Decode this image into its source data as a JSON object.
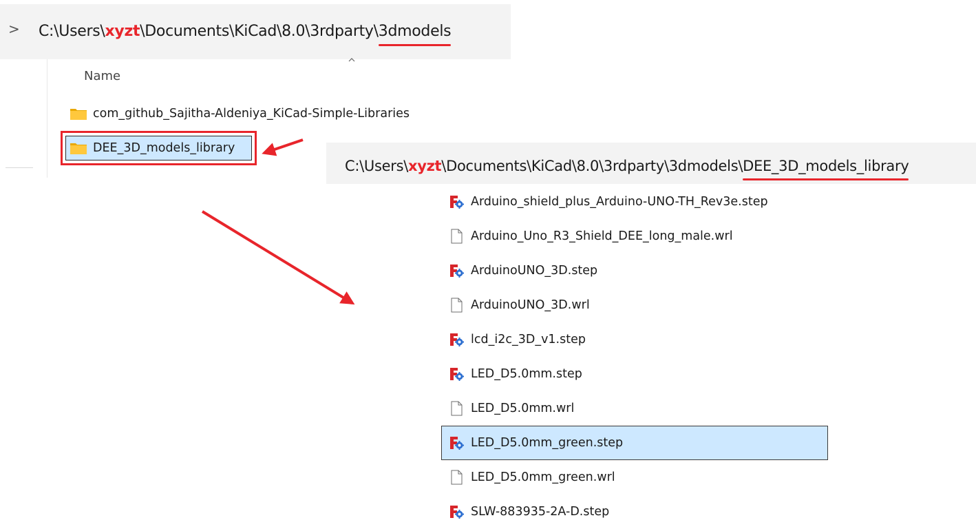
{
  "accent_color": "#e8252b",
  "selection_color": "#cde8ff",
  "top_address_bar": {
    "chevron": ">",
    "path_prefix": "C:\\Users\\",
    "user": "xyzt",
    "path_middle": "\\Documents\\KiCad\\8.0\\3rdparty\\",
    "path_last": "3dmodels"
  },
  "parent_view": {
    "column_header": "Name",
    "folders": [
      {
        "name": "com_github_Sajitha-Aldeniya_KiCad-Simple-Libraries",
        "icon": "folder-icon"
      },
      {
        "name": "DEE_3D_models_library",
        "icon": "folder-icon",
        "highlighted": true
      }
    ]
  },
  "library_address_bar": {
    "path_prefix": "C:\\Users\\",
    "user": "xyzt",
    "path_middle": "\\Documents\\KiCad\\8.0\\3rdparty\\3dmodels\\",
    "path_last": "DEE_3D_models_library"
  },
  "library_files": [
    {
      "name": "Arduino_shield_plus_Arduino-UNO-TH_Rev3e.step",
      "icon": "freecad-step-icon"
    },
    {
      "name": "Arduino_Uno_R3_Shield_DEE_long_male.wrl",
      "icon": "blank-file-icon"
    },
    {
      "name": "ArduinoUNO_3D.step",
      "icon": "freecad-step-icon"
    },
    {
      "name": "ArduinoUNO_3D.wrl",
      "icon": "blank-file-icon"
    },
    {
      "name": "lcd_i2c_3D_v1.step",
      "icon": "freecad-step-icon"
    },
    {
      "name": "LED_D5.0mm.step",
      "icon": "freecad-step-icon"
    },
    {
      "name": "LED_D5.0mm.wrl",
      "icon": "blank-file-icon"
    },
    {
      "name": "LED_D5.0mm_green.step",
      "icon": "freecad-step-icon",
      "selected": true
    },
    {
      "name": "LED_D5.0mm_green.wrl",
      "icon": "blank-file-icon"
    },
    {
      "name": "SLW-883935-2A-D.step",
      "icon": "freecad-step-icon"
    }
  ]
}
